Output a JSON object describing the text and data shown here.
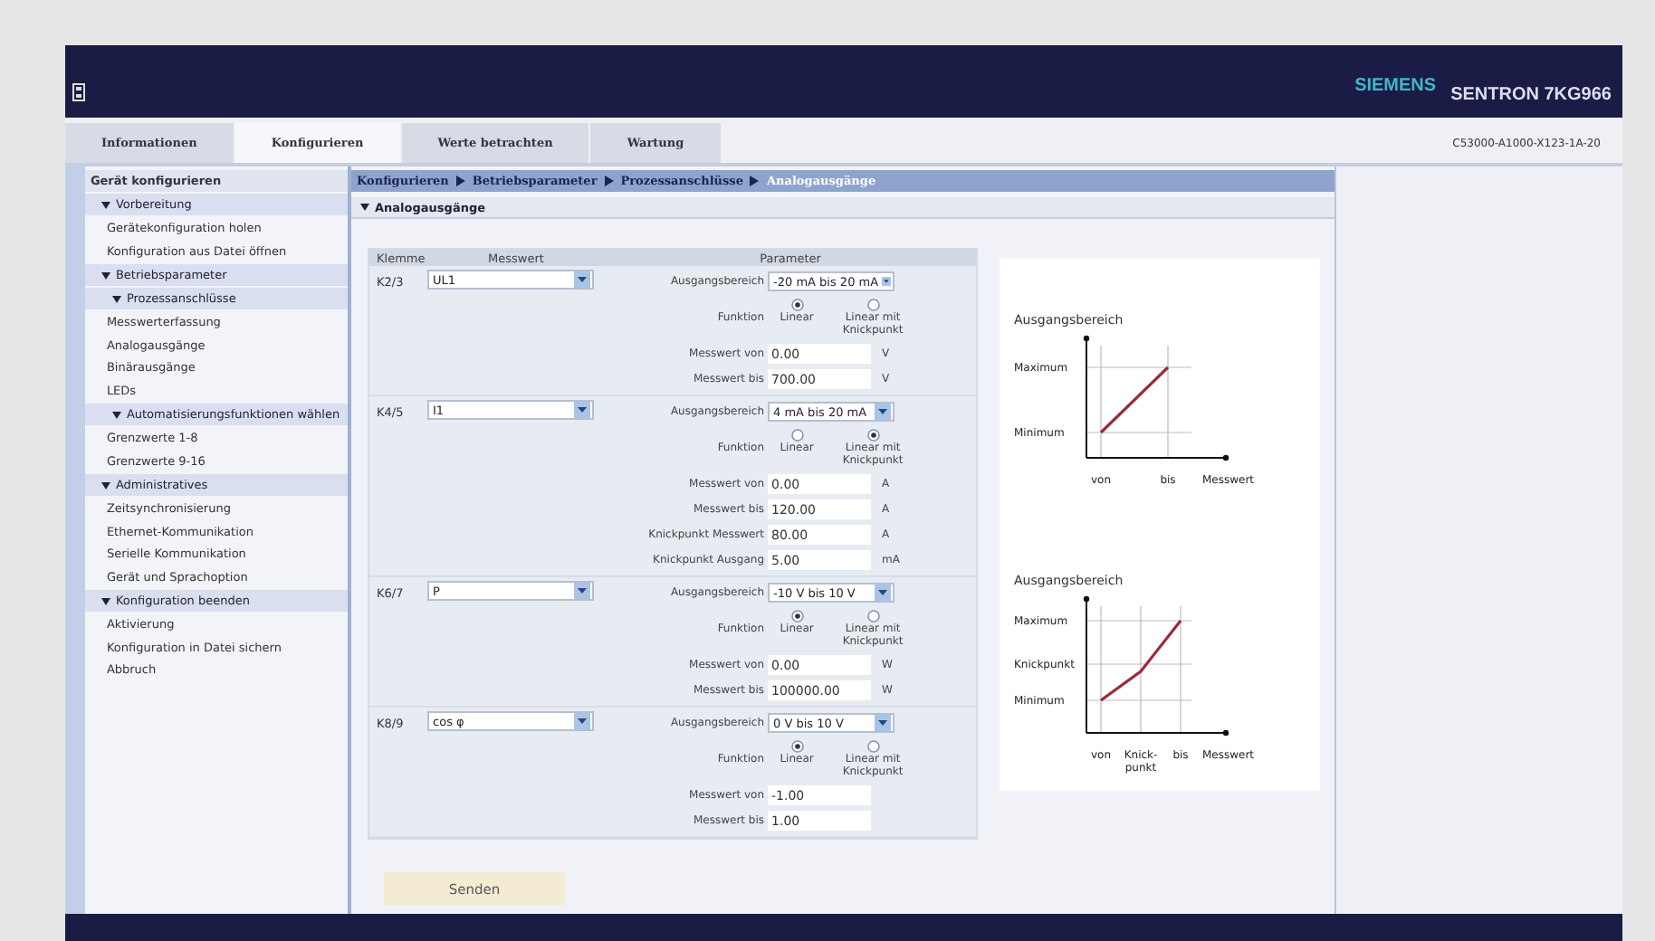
{
  "header": {
    "brand": "SIEMENS",
    "product": "SENTRON 7KG966"
  },
  "tabs": [
    {
      "label": "Informationen",
      "selected": false
    },
    {
      "label": "Konfigurieren",
      "selected": true
    },
    {
      "label": "Werte betrachten",
      "selected": false
    },
    {
      "label": "Wartung",
      "selected": false
    }
  ],
  "order_number": "C53000-A1000-X123-1A-20",
  "sidebar": {
    "title": "Gerät konfigurieren",
    "groups": [
      {
        "label": "Vorbereitung",
        "expanded": true,
        "children": [
          {
            "kind": "item",
            "label": "Gerätekonfiguration holen"
          },
          {
            "kind": "item",
            "label": "Konfiguration aus Datei öffnen"
          }
        ]
      },
      {
        "label": "Betriebsparameter",
        "expanded": true,
        "children": [
          {
            "kind": "group",
            "label": "Prozessanschlüsse",
            "expanded": true,
            "children": [
              {
                "label": "Messwerterfassung"
              },
              {
                "label": "Analogausgänge"
              },
              {
                "label": "Binärausgänge"
              },
              {
                "label": "LEDs"
              }
            ]
          },
          {
            "kind": "group",
            "label": "Automatisierungsfunktionen wählen",
            "expanded": true,
            "children": [
              {
                "label": "Grenzwerte 1-8"
              },
              {
                "label": "Grenzwerte 9-16"
              }
            ]
          }
        ]
      },
      {
        "label": "Administratives",
        "expanded": true,
        "children": [
          {
            "kind": "item",
            "label": "Zeitsynchronisierung"
          },
          {
            "kind": "item",
            "label": "Ethernet-Kommunikation"
          },
          {
            "kind": "item",
            "label": "Serielle Kommunikation"
          },
          {
            "kind": "item",
            "label": "Gerät und Sprachoption"
          }
        ]
      },
      {
        "label": "Konfiguration beenden",
        "expanded": true,
        "children": [
          {
            "kind": "item",
            "label": "Aktivierung"
          },
          {
            "kind": "item",
            "label": "Konfiguration in Datei sichern"
          },
          {
            "kind": "item",
            "label": "Abbruch"
          }
        ]
      }
    ]
  },
  "breadcrumb": [
    "Konfigurieren",
    "Betriebsparameter",
    "Prozessanschlüsse",
    "Analogausgänge"
  ],
  "section": {
    "title": "Analogausgänge",
    "expanded": true
  },
  "table": {
    "columns": [
      "Klemme",
      "Messwert",
      "Parameter"
    ],
    "channels": [
      {
        "terminal": "K2/3",
        "measure": "UL1",
        "params": [
          {
            "kind": "select",
            "label": "Ausgangsbereich",
            "value": "-20 mA bis 20 mA"
          },
          {
            "kind": "radio",
            "label": "Funktion",
            "options": [
              {
                "label": "Linear",
                "selected": true
              },
              {
                "label": "Linear mit Knickpunkt",
                "selected": false
              }
            ]
          },
          {
            "kind": "input",
            "label": "Messwert von",
            "value": "0.00",
            "unit": "V"
          },
          {
            "kind": "input",
            "label": "Messwert bis",
            "value": "700.00",
            "unit": "V"
          }
        ]
      },
      {
        "terminal": "K4/5",
        "measure": "I1",
        "params": [
          {
            "kind": "select",
            "label": "Ausgangsbereich",
            "value": "4 mA bis 20 mA"
          },
          {
            "kind": "radio",
            "label": "Funktion",
            "options": [
              {
                "label": "Linear",
                "selected": false
              },
              {
                "label": "Linear mit Knickpunkt",
                "selected": true
              }
            ]
          },
          {
            "kind": "input",
            "label": "Messwert von",
            "value": "0.00",
            "unit": "A"
          },
          {
            "kind": "input",
            "label": "Messwert bis",
            "value": "120.00",
            "unit": "A"
          },
          {
            "kind": "input",
            "label": "Knickpunkt Messwert",
            "value": "80.00",
            "unit": "A"
          },
          {
            "kind": "input",
            "label": "Knickpunkt Ausgang",
            "value": "5.00",
            "unit": "mA"
          }
        ]
      },
      {
        "terminal": "K6/7",
        "measure": "P",
        "params": [
          {
            "kind": "select",
            "label": "Ausgangsbereich",
            "value": "-10 V bis 10 V"
          },
          {
            "kind": "radio",
            "label": "Funktion",
            "options": [
              {
                "label": "Linear",
                "selected": true
              },
              {
                "label": "Linear mit Knickpunkt",
                "selected": false
              }
            ]
          },
          {
            "kind": "input",
            "label": "Messwert von",
            "value": "0.00",
            "unit": "W"
          },
          {
            "kind": "input",
            "label": "Messwert bis",
            "value": "100000.00",
            "unit": "W"
          }
        ]
      },
      {
        "terminal": "K8/9",
        "measure": "cos φ",
        "params": [
          {
            "kind": "select",
            "label": "Ausgangsbereich",
            "value": "0 V bis 10 V"
          },
          {
            "kind": "radio",
            "label": "Funktion",
            "options": [
              {
                "label": "Linear",
                "selected": true
              },
              {
                "label": "Linear mit Knickpunkt",
                "selected": false
              }
            ]
          },
          {
            "kind": "input",
            "label": "Messwert von",
            "value": "-1.00"
          },
          {
            "kind": "input",
            "label": "Messwert bis",
            "value": "1.00"
          }
        ]
      }
    ]
  },
  "diagrams": [
    {
      "kind": "linear",
      "title": "Ausgangsbereich",
      "y_labels": [
        "Maximum",
        "Minimum"
      ],
      "x_labels": [
        [
          "von"
        ],
        [
          "bis"
        ]
      ],
      "x_title": "Messwert"
    },
    {
      "kind": "knee",
      "title": "Ausgangsbereich",
      "y_labels": [
        "Maximum",
        "Knickpunkt",
        "Minimum"
      ],
      "x_labels": [
        [
          "von"
        ],
        [
          "Knick-",
          "punkt"
        ],
        [
          "bis"
        ]
      ],
      "x_title": "Messwert"
    }
  ],
  "send_button": "Senden"
}
